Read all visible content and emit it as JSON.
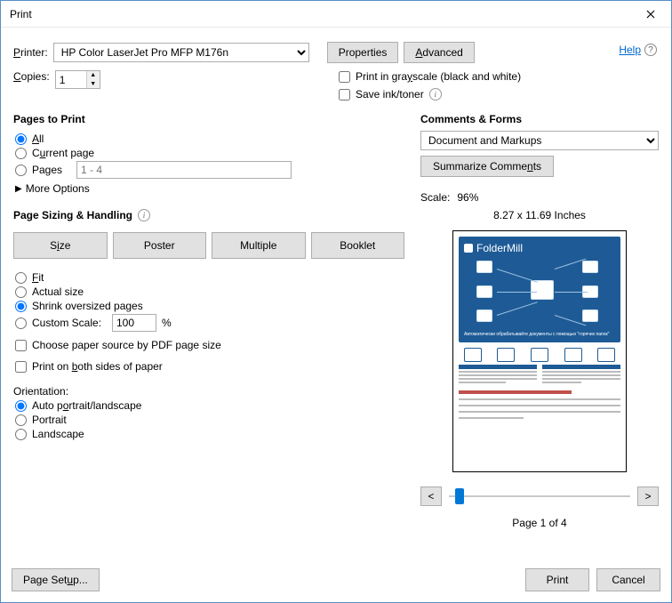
{
  "window": {
    "title": "Print"
  },
  "help": {
    "label": "Help"
  },
  "printer": {
    "label": "Printer:",
    "selected": "HP Color LaserJet Pro MFP M176n",
    "properties_btn": "Properties",
    "advanced_btn": "Advanced"
  },
  "copies": {
    "label": "Copies:",
    "value": "1"
  },
  "options": {
    "grayscale_label": "Print in grayscale (black and white)",
    "saveink_label": "Save ink/toner"
  },
  "pages_to_print": {
    "title": "Pages to Print",
    "all": "All",
    "current": "Current page",
    "pages": "Pages",
    "range_placeholder": "1 - 4",
    "more": "More Options"
  },
  "sizing": {
    "title": "Page Sizing & Handling",
    "size_btn": "Size",
    "poster_btn": "Poster",
    "multiple_btn": "Multiple",
    "booklet_btn": "Booklet",
    "fit": "Fit",
    "actual": "Actual size",
    "shrink": "Shrink oversized pages",
    "custom": "Custom Scale:",
    "custom_value": "100",
    "custom_pct": "%",
    "paper_source": "Choose paper source by PDF page size",
    "both_sides": "Print on both sides of paper"
  },
  "orientation": {
    "title": "Orientation:",
    "auto": "Auto portrait/landscape",
    "portrait": "Portrait",
    "landscape": "Landscape"
  },
  "comments_forms": {
    "title": "Comments & Forms",
    "selected": "Document and Markups",
    "summarize_btn": "Summarize Comments"
  },
  "preview": {
    "scale_label": "Scale:",
    "scale_value": "96%",
    "dimensions": "8.27 x 11.69 Inches",
    "doc_logo": "FolderMill",
    "page_of": "Page 1 of 4",
    "prev": "<",
    "next": ">"
  },
  "footer": {
    "page_setup": "Page Setup...",
    "print": "Print",
    "cancel": "Cancel"
  }
}
